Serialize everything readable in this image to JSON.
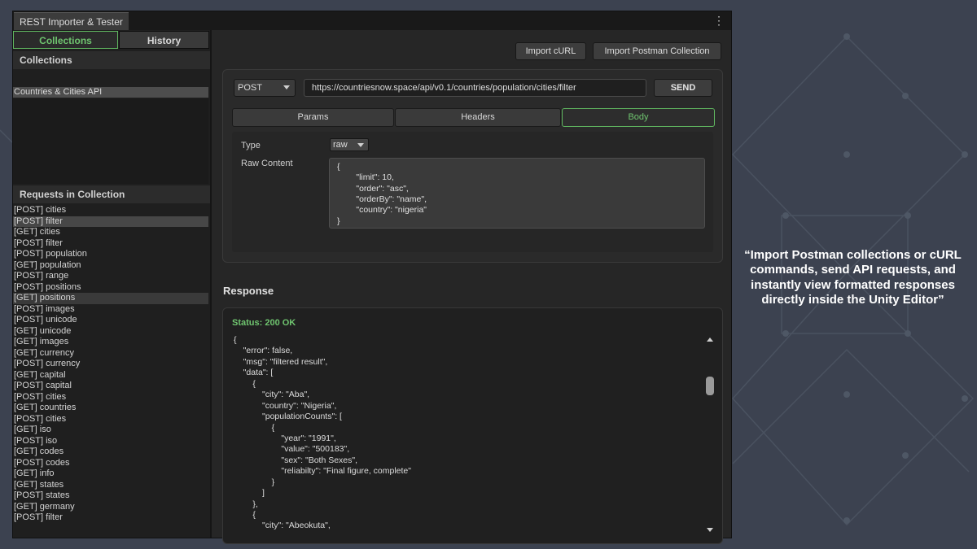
{
  "window": {
    "title": "REST Importer & Tester",
    "menu_icon": "kebab-menu-icon"
  },
  "left_panel": {
    "tabs": [
      {
        "label": "Collections",
        "active": true
      },
      {
        "label": "History",
        "active": false
      }
    ],
    "collections_heading": "Collections",
    "collections": [
      "Countries & Cities API"
    ],
    "requests_heading": "Requests in Collection",
    "requests": [
      "[POST] cities",
      "[POST] filter",
      "[GET] cities",
      "[POST] filter",
      "[POST] population",
      "[GET] population",
      "[POST] range",
      "[POST] positions",
      "[GET] positions",
      "[POST] images",
      "[POST] unicode",
      "[GET] unicode",
      "[GET] images",
      "[GET] currency",
      "[POST] currency",
      "[GET] capital",
      "[POST] capital",
      "[POST] cities",
      "[GET] countries",
      "[POST] cities",
      "[GET] iso",
      "[POST] iso",
      "[GET] codes",
      "[POST] codes",
      "[GET] info",
      "[GET] states",
      "[POST] states",
      "[GET] germany",
      "[POST] filter"
    ]
  },
  "toolbar": {
    "import_curl": "Import cURL",
    "import_postman": "Import Postman Collection"
  },
  "request": {
    "method": "POST",
    "url": "https://countriesnow.space/api/v0.1/countries/population/cities/filter",
    "send_label": "SEND",
    "tabs": [
      "Params",
      "Headers",
      "Body"
    ],
    "active_tab": "Body",
    "body": {
      "type_label": "Type",
      "type_value": "raw",
      "raw_label": "Raw Content",
      "raw_lines": [
        "{",
        "        \"limit\": 10,",
        "        \"order\": \"asc\",",
        "        \"orderBy\": \"name\",",
        "        \"country\": \"nigeria\"",
        "}"
      ]
    }
  },
  "response": {
    "heading": "Response",
    "status": "Status: 200 OK",
    "lines": [
      "{",
      "    \"error\": false,",
      "    \"msg\": \"filtered result\",",
      "    \"data\": [",
      "        {",
      "            \"city\": \"Aba\",",
      "            \"country\": \"Nigeria\",",
      "            \"populationCounts\": [",
      "                {",
      "                    \"year\": \"1991\",",
      "                    \"value\": \"500183\",",
      "                    \"sex\": \"Both Sexes\",",
      "                    \"reliabilty\": \"Final figure, complete\"",
      "                }",
      "            ]",
      "        },",
      "        {",
      "            \"city\": \"Abeokuta\","
    ]
  },
  "tagline": "“Import Postman collections or cURL commands, send API requests, and instantly view formatted responses directly inside the Unity Editor”",
  "colors": {
    "accent_green": "#6fc46f",
    "background": "#3c4250"
  }
}
